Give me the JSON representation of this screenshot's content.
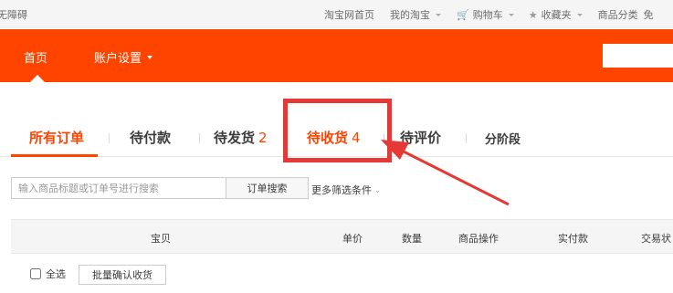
{
  "topbar": {
    "accessibility_text": "无障碍",
    "links": [
      {
        "label": "淘宝网首页",
        "has_caret": false
      },
      {
        "label": "我的淘宝",
        "has_caret": true
      },
      {
        "label": "购物车",
        "has_caret": true,
        "icon": "cart-icon"
      },
      {
        "label": "收藏夹",
        "has_caret": true,
        "icon": "star-icon"
      },
      {
        "label": "商品分类",
        "has_caret": false
      },
      {
        "label": "免",
        "has_caret": false
      }
    ]
  },
  "nav": {
    "home_label": "首页",
    "account_label": "账户设置",
    "search_placeholder": ""
  },
  "tabs": [
    {
      "label": "所有订单",
      "count": "",
      "active": true
    },
    {
      "label": "待付款",
      "count": ""
    },
    {
      "label": "待发货",
      "count": "2"
    },
    {
      "label": "待收货",
      "count": "4",
      "highlighted": true
    },
    {
      "label": "待评价",
      "count": ""
    },
    {
      "label": "分阶段",
      "count": ""
    }
  ],
  "search": {
    "placeholder": "输入商品标题或订单号进行搜索",
    "button_label": "订单搜索",
    "more_filters_label": "更多筛选条件"
  },
  "table_header": [
    "宝贝",
    "单价",
    "数量",
    "商品操作",
    "实付款",
    "交易状"
  ],
  "footer": {
    "select_all_label": "全选",
    "batch_confirm_label": "批量确认收货"
  },
  "colors": {
    "accent": "#ff4400",
    "highlight": "#e53935"
  }
}
